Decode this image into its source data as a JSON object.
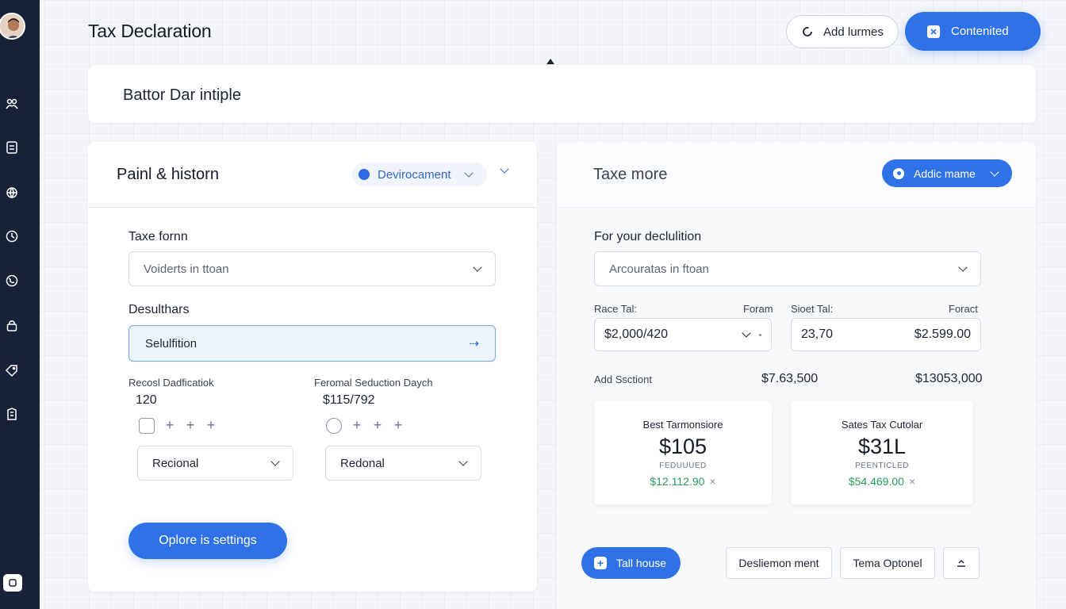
{
  "header": {
    "title": "Tax Declaration",
    "add_button_label": "Add lurmes",
    "primary_button_label": "Contenited"
  },
  "banner": {
    "text": "Battor Dar intiple"
  },
  "left_panel": {
    "title": "Painl & historn",
    "chip_label": "Devirocament",
    "tax_form_label": "Taxe fornn",
    "tax_form_select": "Voiderts in ttoan",
    "deductions_label": "Desulthars",
    "deductions_value": "Selulfition",
    "recent_label": "Recosl Dadficatiok",
    "recent_value": "120",
    "personal_label": "Feromal Seduction Daych",
    "personal_value": "$115/792",
    "select_left": "Recional",
    "select_right": "Redonal",
    "settings_button": "Oplore is settings"
  },
  "right_panel": {
    "title": "Taxe more",
    "chip_label": "Addic mame",
    "declaration_label": "For your declulition",
    "declaration_select": "Arcouratas in ftoan",
    "rate_label": "Race Tal:",
    "rate_right_label": "Foram",
    "rate_value": "$2,000/420",
    "sheet_label": "Sioet Tal:",
    "sheet_right_label": "Foract",
    "sheet_value_left": "23,70",
    "sheet_value_right": "$2.599.00",
    "add_label": "Add Ssctiont",
    "add_value_mid": "$7.63,500",
    "add_value_right": "$13053,000",
    "cards": [
      {
        "title": "Best Tarmonsiore",
        "big": "$105",
        "caption": "FEDUUUED",
        "green": "$12.112.90"
      },
      {
        "title": "Sates Tax Cutolar",
        "big": "$31L",
        "caption": "PEENTICLED",
        "green": "$54.469.00"
      }
    ],
    "tall_button": "Tall house",
    "decl_button": "Desliemon ment",
    "option_button": "Tema Optonel"
  },
  "icons": {
    "sidebar": [
      "users-icon",
      "document-icon",
      "globe-icon",
      "clock-icon",
      "earth-icon",
      "lock-icon",
      "tag-icon",
      "building-icon"
    ],
    "accent": "#2f72e8",
    "sidebar_bg": "#172238"
  }
}
